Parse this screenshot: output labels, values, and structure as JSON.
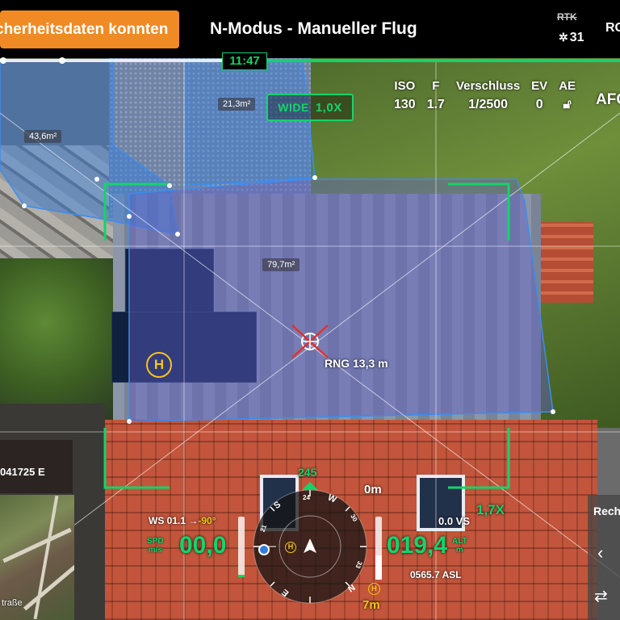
{
  "topbar": {
    "warning": "cherheitsdaten konnten",
    "mode_title": "N-Modus - Manueller Flug",
    "rtk_label": "RTK",
    "satellite_count": "31",
    "right_text": "RO"
  },
  "flight": {
    "time": "11:47"
  },
  "camera": {
    "iso_label": "ISO",
    "iso_value": "130",
    "f_label": "F",
    "f_value": "1.7",
    "shutter_label": "Verschluss",
    "shutter_value": "1/2500",
    "ev_label": "EV",
    "ev_value": "0",
    "ae_label": "AE",
    "focus_mode": "AFC",
    "lens": "WIDE",
    "zoom": "1,0X"
  },
  "measurements": {
    "area_1": "21,3m²",
    "area_2": "43,6m²",
    "area_3": "79,7m²",
    "range": "RNG 13,3 m"
  },
  "home": {
    "marker": "H"
  },
  "side_zoom": "1,7X",
  "position": {
    "coordinate": "041725 E"
  },
  "map": {
    "street": "traße"
  },
  "telemetry": {
    "wind": "WS 01.1 →",
    "wind_dir": "-90°",
    "speed_label_1": "SPD",
    "speed_label_2": "m/s",
    "speed": "00,0",
    "heading": "245",
    "altitude": "019,4",
    "alt_label_1": "ALT",
    "alt_label_2": "m",
    "vertical_speed": "0.0 VS",
    "asl": "0565.7 ASL",
    "top_distance": "0m",
    "bottom_distance": "7m"
  },
  "compass": {
    "n": "N",
    "s": "S",
    "e": "E",
    "w": "W",
    "t21": "21",
    "t24": "24",
    "t30": "30",
    "t33": "33"
  },
  "right_panel": {
    "label": "Rech"
  },
  "icons": {
    "satellite": "satellite-icon",
    "lock": "lock-icon",
    "chevron": "chevron-left-icon",
    "swap": "swap-icon"
  },
  "colors": {
    "accent_green": "#15d36b",
    "warning_orange": "#f08a24",
    "home_yellow": "#f5c518",
    "area_blue": "#2f7de1"
  }
}
